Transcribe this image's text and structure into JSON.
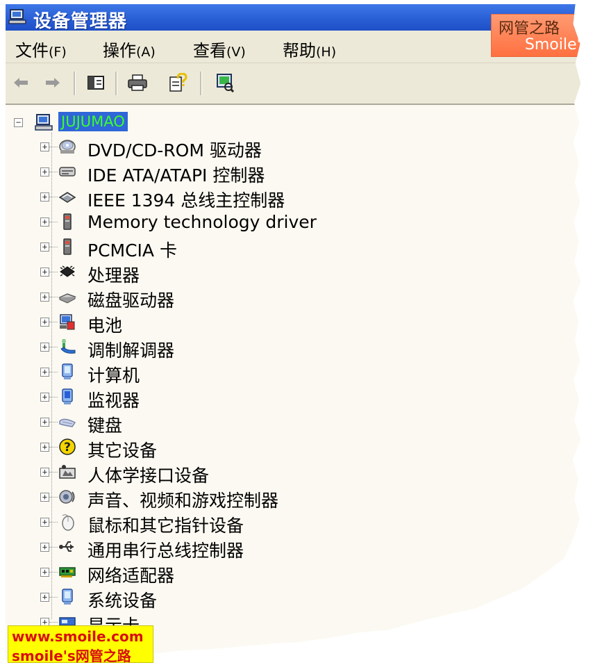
{
  "window": {
    "title": "设备管理器"
  },
  "menu": [
    {
      "label": "文件",
      "accel": "(F)"
    },
    {
      "label": "操作",
      "accel": "(A)"
    },
    {
      "label": "查看",
      "accel": "(V)"
    },
    {
      "label": "帮助",
      "accel": "(H)"
    }
  ],
  "toolbar": {
    "buttons": [
      "back-arrow-icon",
      "forward-arrow-icon",
      "show-hide-tree-icon",
      "print-icon",
      "help-properties-icon",
      "scan-hardware-icon"
    ]
  },
  "tree": {
    "root": {
      "label": "JUJUMAO",
      "expander": "−"
    },
    "items": [
      {
        "label": "DVD/CD-ROM 驱动器",
        "icon": "cd-drive-icon",
        "expander": "+"
      },
      {
        "label": "IDE ATA/ATAPI 控制器",
        "icon": "ide-controller-icon",
        "expander": "+"
      },
      {
        "label": "IEEE 1394 总线主控制器",
        "icon": "ieee1394-icon",
        "expander": "+"
      },
      {
        "label": "Memory technology driver",
        "icon": "memory-card-icon",
        "expander": "+"
      },
      {
        "label": "PCMCIA 卡",
        "icon": "pcmcia-icon",
        "expander": "+"
      },
      {
        "label": "处理器",
        "icon": "processor-icon",
        "expander": "+"
      },
      {
        "label": "磁盘驱动器",
        "icon": "disk-drive-icon",
        "expander": "+"
      },
      {
        "label": "电池",
        "icon": "battery-icon",
        "expander": "+"
      },
      {
        "label": "调制解调器",
        "icon": "modem-icon",
        "expander": "+"
      },
      {
        "label": "计算机",
        "icon": "computer-icon",
        "expander": "+"
      },
      {
        "label": "监视器",
        "icon": "monitor-icon",
        "expander": "+"
      },
      {
        "label": "键盘",
        "icon": "keyboard-icon",
        "expander": "+"
      },
      {
        "label": "其它设备",
        "icon": "unknown-device-icon",
        "expander": "+"
      },
      {
        "label": "人体学接口设备",
        "icon": "hid-icon",
        "expander": "+"
      },
      {
        "label": "声音、视频和游戏控制器",
        "icon": "sound-icon",
        "expander": "+"
      },
      {
        "label": "鼠标和其它指针设备",
        "icon": "mouse-icon",
        "expander": "+"
      },
      {
        "label": "通用串行总线控制器",
        "icon": "usb-icon",
        "expander": "+"
      },
      {
        "label": "网络适配器",
        "icon": "network-adapter-icon",
        "expander": "+"
      },
      {
        "label": "系统设备",
        "icon": "system-device-icon",
        "expander": "+"
      },
      {
        "label": "显示卡",
        "icon": "display-adapter-icon",
        "expander": "+"
      }
    ]
  },
  "watermarks": {
    "top_line1": "网管之路",
    "top_line2": "Smoile's",
    "bottom_line1": "www.smoile.com",
    "bottom_line2": "smoile's网管之路"
  },
  "colors": {
    "titlebar": "#2a5fd6",
    "selection": "#2f66d8",
    "selection_text": "#3cff2b",
    "background": "#fbf9f1"
  }
}
